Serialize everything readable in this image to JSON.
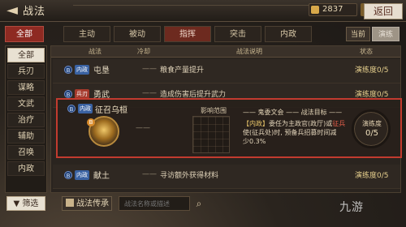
{
  "window": {
    "title": "战法",
    "coin_value": "2837",
    "back_label": "返回",
    "back_icon": "back-arrow-icon",
    "plus_label": "+"
  },
  "tabs": {
    "all": "全部",
    "active": "主动",
    "passive": "被动",
    "command": "指挥",
    "assault": "突击",
    "internal": "内政",
    "current": "当前",
    "train": "演练"
  },
  "sidebar": {
    "items": [
      {
        "label": "全部"
      },
      {
        "label": "兵刃"
      },
      {
        "label": "谋略"
      },
      {
        "label": "文武"
      },
      {
        "label": "治疗"
      },
      {
        "label": "辅助"
      },
      {
        "label": "召唤"
      },
      {
        "label": "内政"
      }
    ]
  },
  "table": {
    "headers": {
      "tactic": "战法",
      "cooldown": "冷却",
      "desc": "战法说明",
      "state": "状态"
    },
    "rows": [
      {
        "badge": "B",
        "tag": "内政",
        "name": "屯垦",
        "cooldown": "——",
        "desc": "粮食产量提升",
        "state": "演练度0/5"
      },
      {
        "badge": "B",
        "tag": "兵刃",
        "name": "勇武",
        "cooldown": "——",
        "desc": "造成伤害后提升武力",
        "state": "演练度0/5"
      },
      {
        "badge": "B",
        "tag": "内政",
        "name": "献土",
        "cooldown": "——",
        "desc": "寻访额外获得材料",
        "state": "演练度0/5"
      }
    ]
  },
  "detail": {
    "badge": "B",
    "tag": "内政",
    "name": "征召乌桓",
    "quality": "B",
    "cooldown": "——",
    "range_label": "影响范围",
    "title_pre": "—— 鬼委文会 —— 战法目标 ——",
    "text_line1_a": "【内政】",
    "text_line1_b": "委任为主政官(政厅)或",
    "text_line1_c": "征兵",
    "text_line2": "使(征兵处)时, 预备兵招募时间减",
    "text_line3": "少0.3%",
    "progress_label": "演练度",
    "progress_value": "0/5"
  },
  "bottom": {
    "filter_label": "筛选",
    "inherit_label": "战法传承",
    "search_placeholder": "战法名称或描述",
    "watermark": "九游"
  },
  "colors": {
    "accent_red": "#8e2a22",
    "border_red": "#c23b2f",
    "tag_blue": "#3a62a2",
    "tag_red": "#a53a2c"
  }
}
